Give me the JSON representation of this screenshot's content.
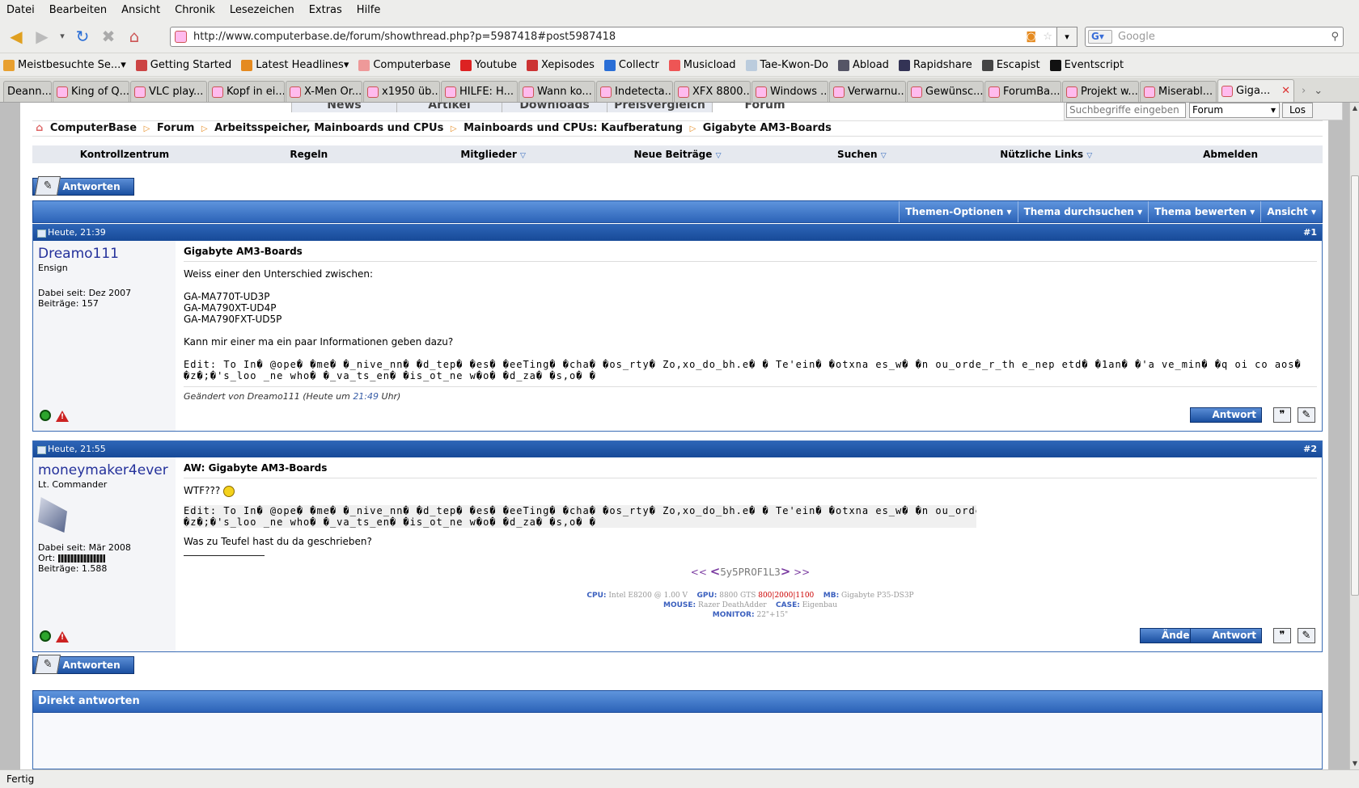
{
  "menu": [
    "Datei",
    "Bearbeiten",
    "Ansicht",
    "Chronik",
    "Lesezeichen",
    "Extras",
    "Hilfe"
  ],
  "url": "http://www.computerbase.de/forum/showthread.php?p=5987418#post5987418",
  "google_placeholder": "Google",
  "bookmarks": [
    "Meistbesuchte Se...",
    "Getting Started",
    "Latest Headlines",
    "Computerbase",
    "Youtube",
    "Xepisodes",
    "Collectr",
    "Musicload",
    "Tae-Kwon-Do",
    "Abload",
    "Rapidshare",
    "Escapist",
    "Eventscript"
  ],
  "tabs": [
    "Deann...",
    "King of Q...",
    "VLC play...",
    "Kopf in ei...",
    "X-Men Or...",
    "x1950 üb...",
    "HILFE: H...",
    "Wann ko...",
    "Indetecta...",
    "XFX 8800...",
    "Windows ...",
    "Verwarnu...",
    "Gewünsc...",
    "ForumBa...",
    "Projekt w...",
    "Miserabl...",
    "Giga..."
  ],
  "site": {
    "topnav": [
      "News",
      "Artikel",
      "Downloads",
      "Preisvergleich",
      "Forum"
    ],
    "search_placeholder": "Suchbegriffe eingeben",
    "search_scope": "Forum",
    "search_button": "Los",
    "breadcrumb": [
      "ComputerBase",
      "Forum",
      "Arbeitsspeicher, Mainboards und CPUs",
      "Mainboards und CPUs: Kaufberatung",
      "Gigabyte AM3-Boards"
    ],
    "navrow": [
      "Kontrollzentrum",
      "Regeln",
      "Mitglieder",
      "Neue Beiträge",
      "Suchen",
      "Nützliche Links",
      "Abmelden"
    ],
    "reply_button": "Antworten",
    "thread_options": [
      "Themen-Optionen",
      "Thema durchsuchen",
      "Thema bewerten",
      "Ansicht"
    ],
    "direct_reply": "Direkt antworten"
  },
  "posts": [
    {
      "date": "Heute, 21:39",
      "num": "#1",
      "user": "Dreamo111",
      "rank": "Ensign",
      "joined": "Dabei seit: Dez 2007",
      "posts_count": "Beiträge: 157",
      "title": "Gigabyte AM3-Boards",
      "line1": "Weiss einer den Unterschied zwischen:",
      "boards": [
        "GA-MA770T-UD3P",
        "GA-MA790XT-UD4P",
        "GA-MA790FXT-UD5P"
      ],
      "line2": "Kann mir einer ma ein paar Informationen geben dazu?",
      "edit_line1": "Edit: To In� @ope� �me� �_nive_nn� �d_tep� �es� �eeTing� �cha� �os_rty� Zo,xo_do_bh.e� � Te'ein� �otxna es_w� �n ou_orde_r_th e_nep etd� �1an� �'a ve_min� �q oi co aos�",
      "edit_line2": "�z�;�'s_loo _ne who� �_va_ts_en� �is_ot_ne w�o� �d_za� �s,o� �",
      "edited_prefix": "Geändert von Dreamo111 (Heute um",
      "edited_time": "21:49",
      "edited_suffix": "Uhr)",
      "btn_reply": "Antwort"
    },
    {
      "date": "Heute, 21:55",
      "num": "#2",
      "user": "moneymaker4ever",
      "rank": "Lt. Commander",
      "joined": "Dabei seit: Mär 2008",
      "location": "Ort:",
      "posts_count": "Beiträge: 1.588",
      "title": "AW: Gigabyte AM3-Boards",
      "line1": "WTF???",
      "edit_line1": "Edit: To In� @ope� �me� �_nive_nn� �d_tep� �es� �eeTing� �cha� �os_rty� Zo,xo_do_bh.e� � Te'ein� �otxna es_w� �n ou_orde_r_th e_nep",
      "edit_line2": "�z�;�'s_loo _ne who� �_va_ts_en� �is_ot_ne w�o� �d_za� �s,o� �",
      "line2": "Was zu Teufel hast du da geschrieben?",
      "sig_left": "<<",
      "sig_lt": "<",
      "sig_name": "5y5PR0F1L3",
      "sig_gt": ">",
      "sig_right": ">>",
      "spec_cpu_k": "CPU:",
      "spec_cpu_v": "Intel E8200 @ 1.00 V",
      "spec_gpu_k": "GPU:",
      "spec_gpu_v": "8800 GTS",
      "spec_gpu_clk": "800|2000|1100",
      "spec_mb_k": "MB:",
      "spec_mb_v": "Gigabyte P35-DS3P",
      "spec_mouse_k": "MOUSE:",
      "spec_mouse_v": "Razer DeathAdder",
      "spec_case_k": "CASE:",
      "spec_case_v": "Eigenbau",
      "spec_mon_k": "MONITOR:",
      "spec_mon_v": "22\"+15\"",
      "btn_edit": "Ändern",
      "btn_reply": "Antwort"
    }
  ],
  "status": "Fertig"
}
